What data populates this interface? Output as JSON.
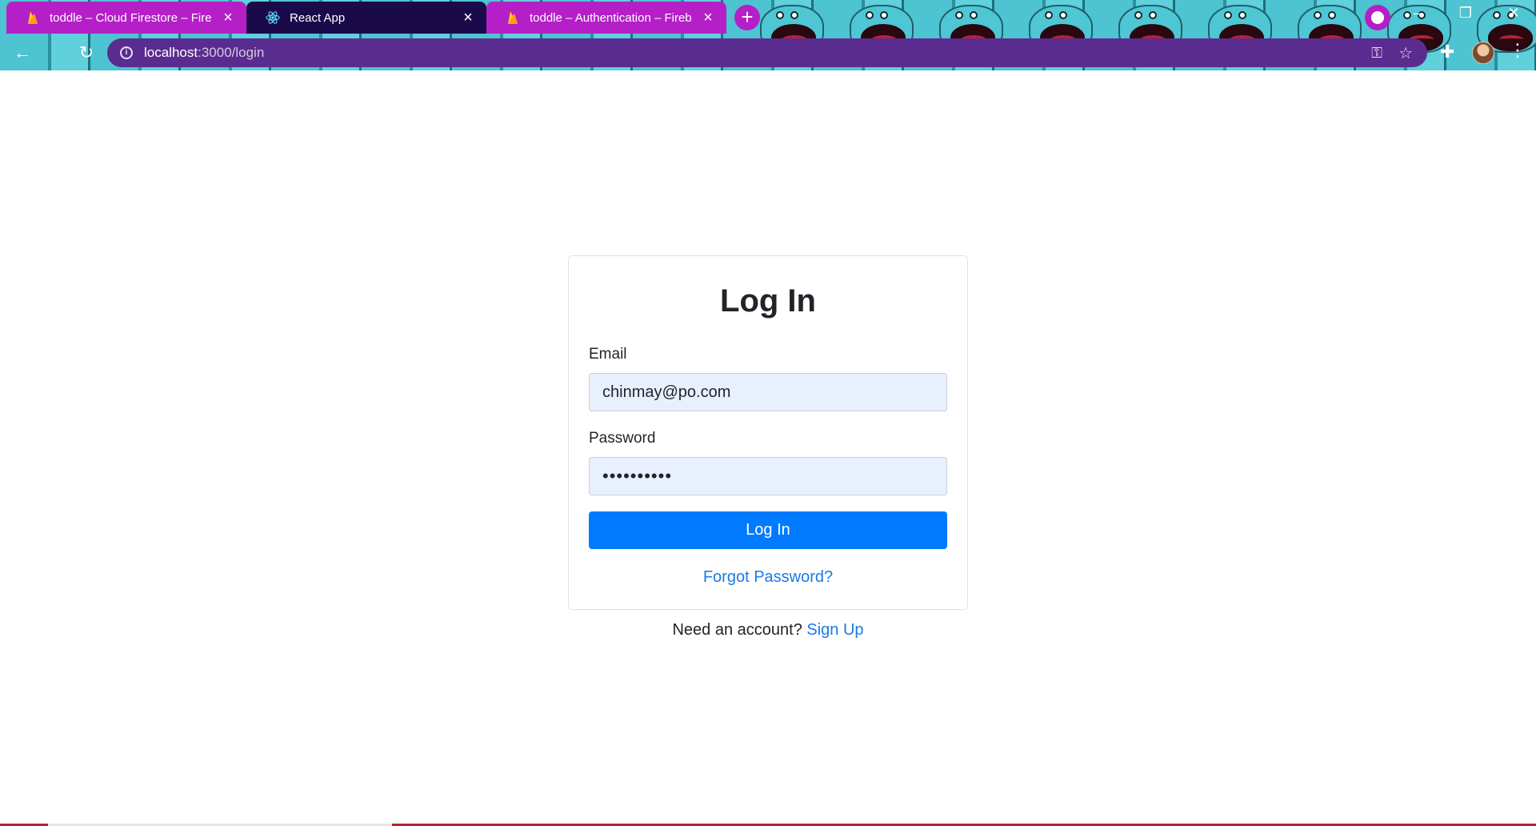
{
  "browser": {
    "tabs": [
      {
        "title": "toddle – Cloud Firestore – Firebase",
        "icon": "firebase-icon",
        "state": "inactive"
      },
      {
        "title": "React App",
        "icon": "react-icon",
        "state": "active"
      },
      {
        "title": "toddle – Authentication – Firebase",
        "icon": "firebase-icon",
        "state": "inactive"
      }
    ],
    "tab_close_glyph": "×",
    "new_tab_glyph": "+",
    "url_host": "localhost",
    "url_path": ":3000/login",
    "accent_color": "#b51fc7",
    "toolbar_color": "#5b2c8f"
  },
  "login": {
    "title": "Log In",
    "email_label": "Email",
    "email_value": "chinmay@po.com",
    "password_label": "Password",
    "password_value": "••••••••••",
    "submit_label": "Log In",
    "forgot_link": "Forgot Password?",
    "signup_prompt": "Need an account?",
    "signup_link": "Sign Up",
    "primary_color": "#007bff",
    "link_color": "#1a7ae6"
  }
}
